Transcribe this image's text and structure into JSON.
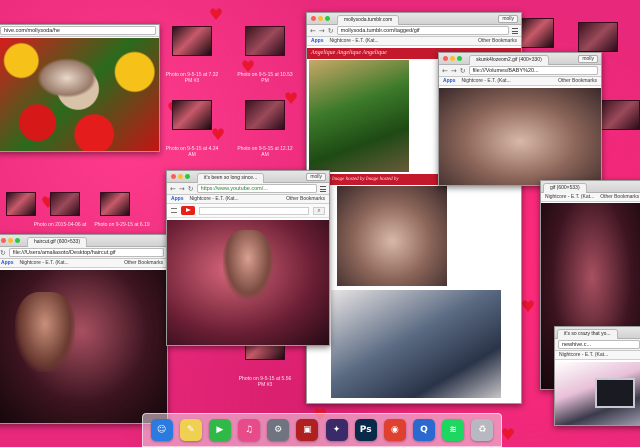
{
  "desktop": {
    "thumbnails": [
      {
        "label": "Photo on 9-5-15 at 7.32 PM #3"
      },
      {
        "label": "Photo on 9-5-15 at 10.53 PM"
      },
      {
        "label": "Photo on 9-5-15 at 4.24 AM"
      },
      {
        "label": "Photo on 9-5-15 at 12.12 AM"
      },
      {
        "label": "Photo on 9-5-15 at 5.56 PM #3"
      },
      {
        "label": "Photo on 2015-04-06 at"
      },
      {
        "label": "Photo on 9-29-15 at 6.19"
      }
    ]
  },
  "windows": {
    "left_browser": {
      "url": "hive.com/mollysoda/he"
    },
    "tumblr": {
      "tab": "mollysoda.tumblr.com",
      "profile": "molly",
      "url": "mollysoda.tumblr.com/tagged/gif",
      "bookmarks": {
        "apps": "Apps",
        "item": "Nightcore - E.T. (Kat...",
        "other": "Other Bookmarks"
      },
      "banner": "Angelique Angelique Angelique",
      "caption": "Posted by Image hosted by Image hosted by"
    },
    "skunk": {
      "tab": "skunk4lozeom2.gif (400×330)",
      "profile": "molly",
      "url": "file:///Volumes/BABY%20...",
      "bookmarks": {
        "apps": "Apps",
        "item": "Nightcore - E.T. (Kat...",
        "other": "Other Bookmarks"
      }
    },
    "youtube": {
      "tab": "it's been so long since...",
      "profile": "molly",
      "url": "https://www.youtube.com/...",
      "bookmarks": {
        "apps": "Apps",
        "item": "Nightcore - E.T. (Kat...",
        "other": "Other Bookmarks"
      }
    },
    "haircut": {
      "tab": "haircut.gif (600×533)",
      "url": "file:///Users/amaliasoto/Desktop/haircut.gif",
      "bookmarks": {
        "apps": "Apps",
        "item": "Nightcore - E.T. (Kat...",
        "other": "Other Bookmarks"
      }
    },
    "right_gif": {
      "tab": "gif (600×533)",
      "bookmarks": {
        "item": "Nightcore - E.T. (Kat...",
        "other": "Other Bookmarks"
      }
    },
    "newhive": {
      "tab": "it's so crazy that yo...",
      "url": "newhive.c...",
      "bookmarks": {
        "item": "Nightcore - E.T. (Kat..."
      }
    }
  },
  "dock": {
    "icons": [
      {
        "name": "finder-icon",
        "glyph": "☺",
        "color": "#2a7ae0"
      },
      {
        "name": "notes-icon",
        "glyph": "✎",
        "color": "#f0d050"
      },
      {
        "name": "facetime-icon",
        "glyph": "▶",
        "color": "#30b848"
      },
      {
        "name": "itunes-icon",
        "glyph": "♫",
        "color": "#e84a8a"
      },
      {
        "name": "system-preferences-icon",
        "glyph": "⚙",
        "color": "#707480"
      },
      {
        "name": "photo-booth-icon",
        "glyph": "▣",
        "color": "#b02020"
      },
      {
        "name": "final-cut-icon",
        "glyph": "✦",
        "color": "#3a2a6a"
      },
      {
        "name": "photoshop-icon",
        "glyph": "Ps",
        "color": "#0a2a4a"
      },
      {
        "name": "chrome-icon",
        "glyph": "◉",
        "color": "#e04030"
      },
      {
        "name": "quicktime-icon",
        "glyph": "Q",
        "color": "#2a6ad0"
      },
      {
        "name": "spotify-icon",
        "glyph": "≋",
        "color": "#1ed760"
      },
      {
        "name": "trash-icon",
        "glyph": "♻",
        "color": "#b8b8c0"
      }
    ]
  }
}
